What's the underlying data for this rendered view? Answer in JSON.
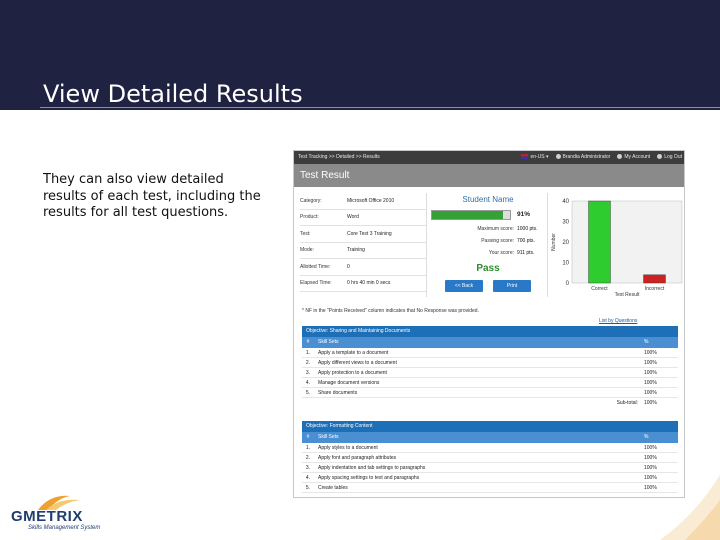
{
  "slide": {
    "title": "View Detailed Results",
    "body": "They can also view detailed results of each test, including the results for all test questions."
  },
  "app": {
    "breadcrumb": "Test Tracking >> Detailed >> Results",
    "language": "en-US",
    "user_role": "Brandia Administrator",
    "my_account": "My Account",
    "log_out": "Log Out",
    "page_title": "Test Result"
  },
  "info": [
    {
      "label": "Category:",
      "value": "Microsoft Office 2010"
    },
    {
      "label": "Product:",
      "value": "Word"
    },
    {
      "label": "Test:",
      "value": "Core Test 3 Training"
    },
    {
      "label": "Mode:",
      "value": "Training"
    },
    {
      "label": "Allotted Time:",
      "value": "0"
    },
    {
      "label": "Elapsed Time:",
      "value": "0 hrs 40 min 0 secs"
    }
  ],
  "result": {
    "student_name": "Student Name",
    "progress_fraction": 0.91,
    "percent_label": "91%",
    "scores": [
      {
        "label": "Maximum score:",
        "value": "1000 pts."
      },
      {
        "label": "Passing score:",
        "value": "700 pts."
      },
      {
        "label": "Your score:",
        "value": "911 pts."
      }
    ],
    "status": "Pass",
    "back_label": "<< Back",
    "print_label": "Print"
  },
  "chart_data": {
    "type": "bar",
    "categories": [
      "Correct",
      "Incorrect"
    ],
    "values": [
      40,
      4
    ],
    "colors": [
      "#2ecc2e",
      "#cc2222"
    ],
    "ylim": [
      0,
      40
    ],
    "yticks": [
      0,
      10,
      20,
      30,
      40
    ],
    "ylabel": "Number",
    "xlabel": "Test Result",
    "title": "",
    "grid": false
  },
  "note": "* NF in the \"Points Received\" column indicates that No Response was provided.",
  "list_link": "List by Questions",
  "table_headers": {
    "num": "#",
    "skill": "Skill Sets",
    "pct": "%"
  },
  "objectives": [
    {
      "title": "Objective: Sharing and Maintaining Documents",
      "rows": [
        {
          "n": "1.",
          "skill": "Apply a template to a document",
          "pct": "100%"
        },
        {
          "n": "2.",
          "skill": "Apply different views to a document",
          "pct": "100%"
        },
        {
          "n": "3.",
          "skill": "Apply protection to a document",
          "pct": "100%"
        },
        {
          "n": "4.",
          "skill": "Manage document versions",
          "pct": "100%"
        },
        {
          "n": "5.",
          "skill": "Share documents",
          "pct": "100%"
        }
      ],
      "subtotal_label": "Sub-total:",
      "subtotal": "100%"
    },
    {
      "title": "Objective: Formatting Content",
      "rows": [
        {
          "n": "1.",
          "skill": "Apply styles to a document",
          "pct": "100%"
        },
        {
          "n": "2.",
          "skill": "Apply font and paragraph attributes",
          "pct": "100%"
        },
        {
          "n": "3.",
          "skill": "Apply indentation and tab settings to paragraphs",
          "pct": "100%"
        },
        {
          "n": "4.",
          "skill": "Apply spacing settings to text and paragraphs",
          "pct": "100%"
        },
        {
          "n": "5.",
          "skill": "Create tables",
          "pct": "100%"
        }
      ]
    }
  ],
  "logo": {
    "name": "GMETRIX",
    "tagline": "Skills Management System"
  },
  "colors": {
    "header_bg": "#1f2241",
    "objective_bg": "#1d6fb8",
    "pass_green": "#2e8b2e",
    "button_blue": "#2a78c8"
  }
}
